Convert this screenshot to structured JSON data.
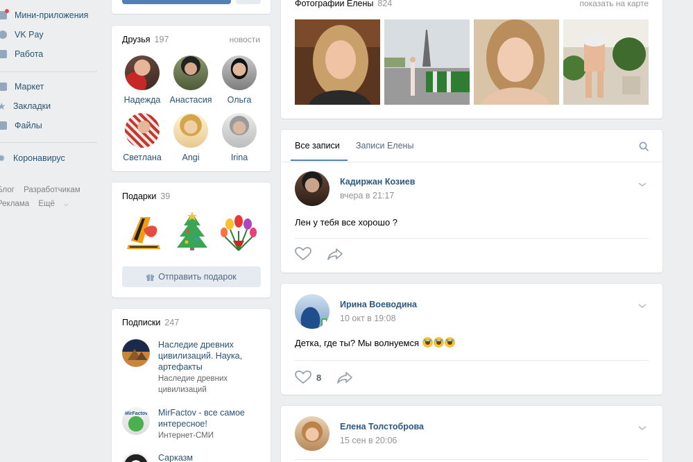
{
  "left_menu": {
    "items": [
      {
        "label": "Мини-приложения",
        "icon": "apps-icon"
      },
      {
        "label": "VK Pay",
        "icon": "vkpay-icon"
      },
      {
        "label": "Работа",
        "icon": "briefcase-icon"
      },
      {
        "label": "Маркет",
        "icon": "shop-icon"
      },
      {
        "label": "Закладки",
        "icon": "star-icon"
      },
      {
        "label": "Файлы",
        "icon": "file-icon"
      },
      {
        "label": "Коронавирус",
        "icon": "virus-icon"
      }
    ],
    "footer": [
      "Блог",
      "Разработчикам",
      "Реклама",
      "Ещё"
    ]
  },
  "friends": {
    "title": "Друзья",
    "count": "197",
    "link": "новости",
    "list": [
      {
        "name": "Надежда"
      },
      {
        "name": "Анастасия"
      },
      {
        "name": "Ольга"
      },
      {
        "name": "Светлана"
      },
      {
        "name": "Angi"
      },
      {
        "name": "Irina"
      }
    ]
  },
  "gifts": {
    "title": "Подарки",
    "count": "39",
    "button": "Отправить подарок",
    "items": [
      "ribbon-gift",
      "tree-gift",
      "flowers-gift"
    ]
  },
  "subscriptions": {
    "title": "Подписки",
    "count": "247",
    "list": [
      {
        "name": "Наследие древних цивилизаций. Наука, артефакты",
        "desc": "Наследие древних цивилизаций"
      },
      {
        "name": "MirFactov - все самое интересное!",
        "desc": "Интернет-СМИ"
      },
      {
        "name": "Сарказм",
        "desc": ""
      }
    ]
  },
  "photos": {
    "title": "Фотографии Елены",
    "count": "824",
    "link": "показать на карте"
  },
  "wall": {
    "tabs": [
      {
        "label": "Все записи",
        "active": true
      },
      {
        "label": "Записи Елены",
        "active": false
      }
    ]
  },
  "posts": [
    {
      "author": "Кадиржан Козиев",
      "date": "вчера в 21:17",
      "text": "Лен у тебя все хорошо ?",
      "likes": ""
    },
    {
      "author": "Ирина Воеводина",
      "date": "10 окт в 19:08",
      "text": "Детка, где ты? Мы волнуемся",
      "likes": "8"
    },
    {
      "author": "Елена Толстоброва",
      "date": "15 сен в 20:06",
      "text": "",
      "likes": ""
    }
  ],
  "colors": {
    "background": "#edeef0",
    "link": "#2a5885",
    "accent": "#5181b8"
  }
}
